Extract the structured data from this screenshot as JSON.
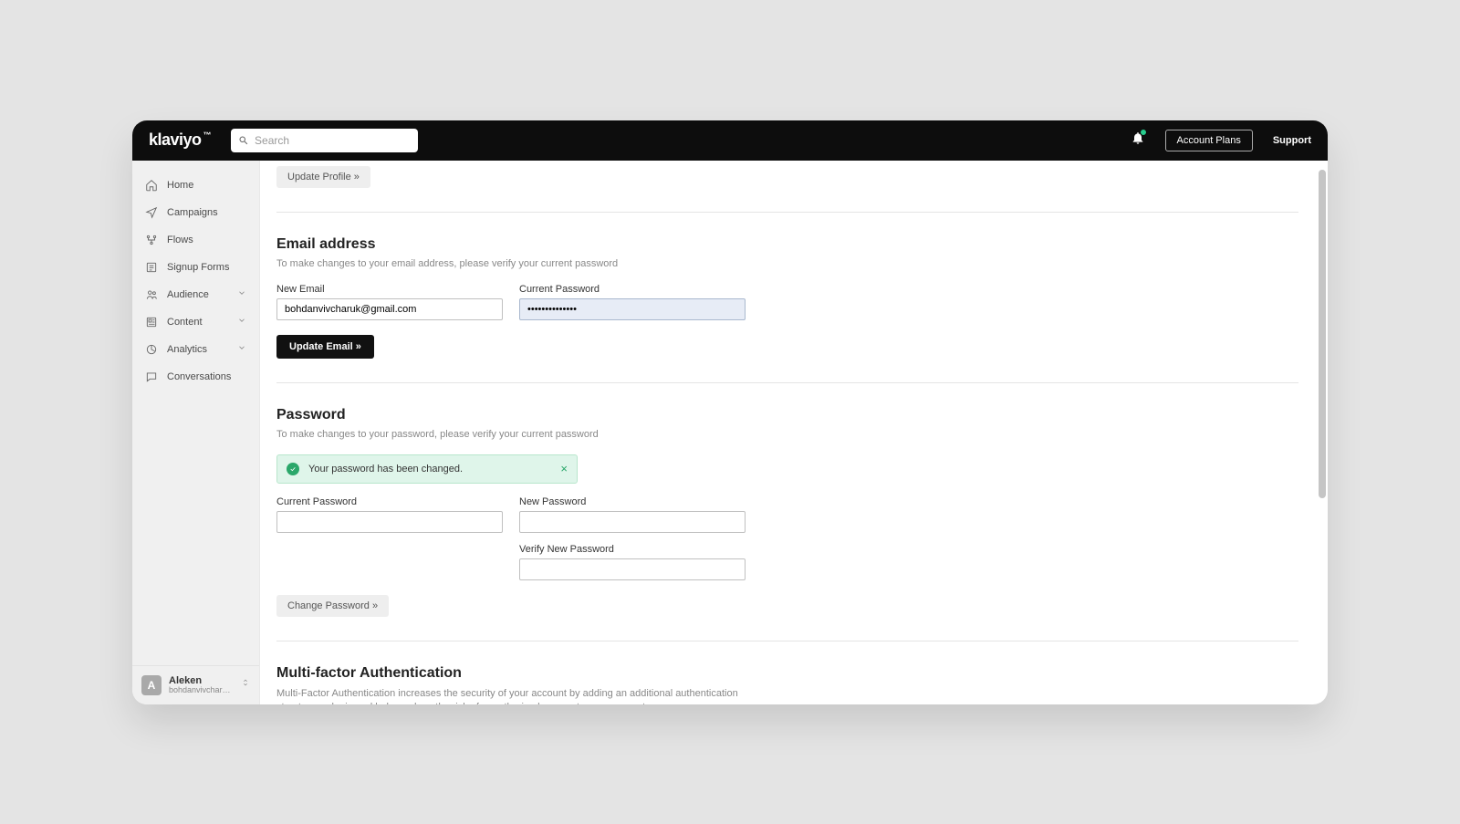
{
  "brand": "klaviyo",
  "search": {
    "placeholder": "Search"
  },
  "topbar": {
    "account_plans": "Account Plans",
    "support": "Support"
  },
  "sidebar": {
    "items": [
      {
        "label": "Home"
      },
      {
        "label": "Campaigns"
      },
      {
        "label": "Flows"
      },
      {
        "label": "Signup Forms"
      },
      {
        "label": "Audience"
      },
      {
        "label": "Content"
      },
      {
        "label": "Analytics"
      },
      {
        "label": "Conversations"
      }
    ],
    "account": {
      "initial": "A",
      "name": "Aleken",
      "email": "bohdanvivcharu..."
    }
  },
  "profile": {
    "update_button": "Update Profile »"
  },
  "email": {
    "title": "Email address",
    "desc": "To make changes to your email address, please verify your current password",
    "new_email_label": "New Email",
    "new_email_value": "bohdanvivcharuk@gmail.com",
    "current_password_label": "Current Password",
    "current_password_value": "••••••••••••••",
    "update_button": "Update Email »"
  },
  "password": {
    "title": "Password",
    "desc": "To make changes to your password, please verify your current password",
    "alert": "Your password has been changed.",
    "current_label": "Current Password",
    "new_label": "New Password",
    "verify_label": "Verify New Password",
    "change_button": "Change Password »"
  },
  "mfa": {
    "title": "Multi-factor Authentication",
    "desc": "Multi-Factor Authentication increases the security of your account by adding an additional authentication step to your login and helps reduce the risk of unauthorized access to your account."
  }
}
